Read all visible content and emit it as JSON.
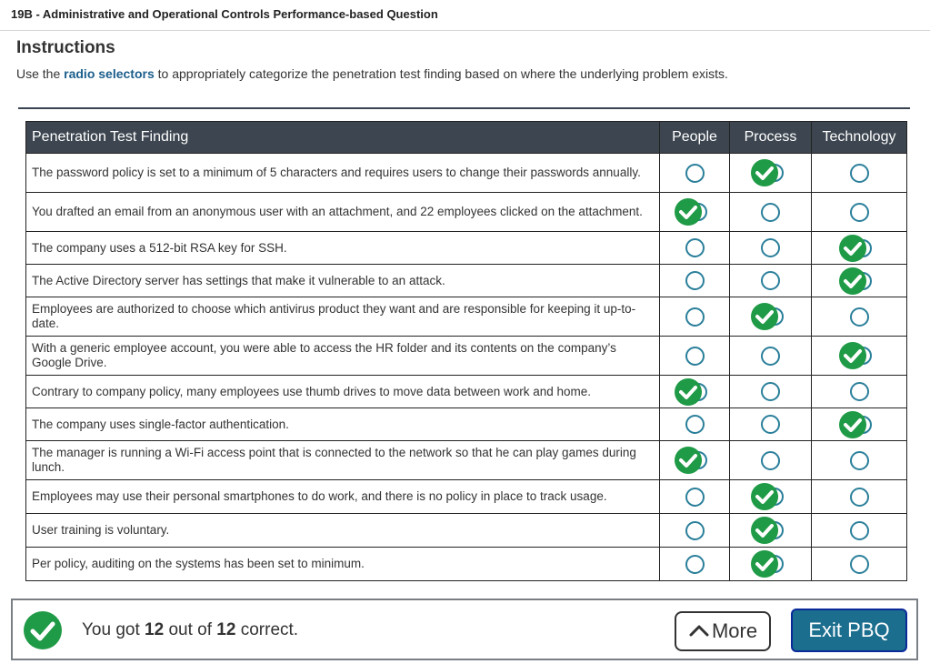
{
  "header": {
    "question_title": "19B - Administrative and Operational Controls Performance-based Question"
  },
  "instructions": {
    "heading": "Instructions",
    "text_before": "Use the ",
    "highlight": "radio selectors",
    "text_after": " to appropriately categorize the penetration test finding based on where the underlying problem exists."
  },
  "table": {
    "headers": {
      "finding": "Penetration Test Finding",
      "people": "People",
      "process": "Process",
      "technology": "Technology"
    },
    "rows": [
      {
        "finding": "The password policy is set to a minimum of 5 characters and requires users to change their passwords annually.",
        "selected": "Process"
      },
      {
        "finding": "You drafted an email from an anonymous user with an attachment, and 22 employees clicked on the attachment.",
        "selected": "People"
      },
      {
        "finding": "The company uses a 512-bit RSA key for SSH.",
        "selected": "Technology"
      },
      {
        "finding": "The Active Directory server has settings that make it vulnerable to an attack.",
        "selected": "Technology"
      },
      {
        "finding": "Employees are authorized to choose which antivirus product they want and are responsible for keeping it up-to-date.",
        "selected": "Process"
      },
      {
        "finding": "With a generic employee account, you were able to access the HR folder and its contents on the company’s Google Drive.",
        "selected": "Technology"
      },
      {
        "finding": "Contrary to company policy, many employees use thumb drives to move data between work and home.",
        "selected": "People"
      },
      {
        "finding": "The company uses single-factor authentication.",
        "selected": "Technology"
      },
      {
        "finding": "The manager is running a Wi-Fi access point that is connected to the network so that he can play games during lunch.",
        "selected": "People"
      },
      {
        "finding": "Employees may use their personal smartphones to do work, and there is no policy in place to track usage.",
        "selected": "Process"
      },
      {
        "finding": "User training is voluntary.",
        "selected": "Process"
      },
      {
        "finding": "Per policy, auditing on the systems has been set to minimum.",
        "selected": "Process"
      }
    ]
  },
  "footer": {
    "score_prefix": "You got ",
    "score_correct": "12",
    "score_middle": " out of ",
    "score_total": "12",
    "score_suffix": " correct.",
    "more_label": "More",
    "exit_label": "Exit PBQ"
  },
  "colors": {
    "correct_green": "#1f9a46",
    "radio_teal": "#2a7f9a",
    "header_bg": "#3d4650",
    "exit_bg": "#1b6e8e"
  }
}
